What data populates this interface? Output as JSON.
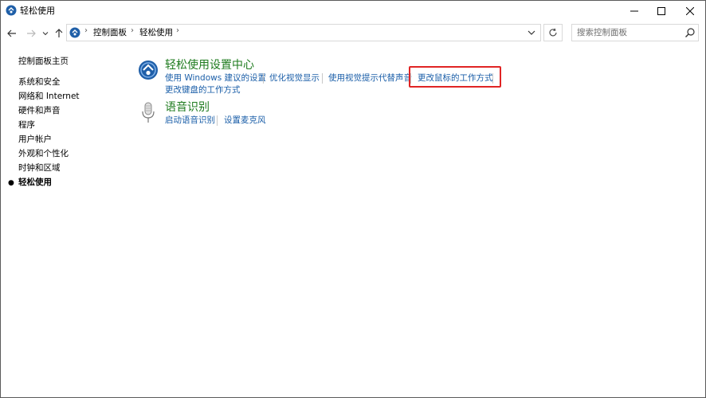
{
  "window": {
    "title": "轻松使用"
  },
  "address_bar": {
    "crumbs": [
      "控制面板",
      "轻松使用"
    ]
  },
  "search": {
    "placeholder": "搜索控制面板"
  },
  "sidebar": {
    "items": [
      {
        "label": "控制面板主页"
      },
      {
        "label": "系统和安全"
      },
      {
        "label": "网络和 Internet"
      },
      {
        "label": "硬件和声音"
      },
      {
        "label": "程序"
      },
      {
        "label": "用户帐户"
      },
      {
        "label": "外观和个性化"
      },
      {
        "label": "时钟和区域"
      },
      {
        "label": "轻松使用",
        "active": true
      }
    ]
  },
  "categories": [
    {
      "title": "轻松使用设置中心",
      "links": [
        "使用 Windows 建议的设置",
        "优化视觉显示",
        "使用视觉提示代替声音",
        "更改鼠标的工作方式",
        "更改键盘的工作方式"
      ]
    },
    {
      "title": "语音识别",
      "links": [
        "启动语音识别",
        "设置麦克风"
      ]
    }
  ],
  "colors": {
    "category_title": "#1e7b1e",
    "link": "#1a5ea8",
    "highlight": "#e02424"
  },
  "icons": {
    "title": "ease-of-access-icon",
    "ease_center": "ease-of-access-center-icon",
    "speech": "microphone-icon"
  }
}
